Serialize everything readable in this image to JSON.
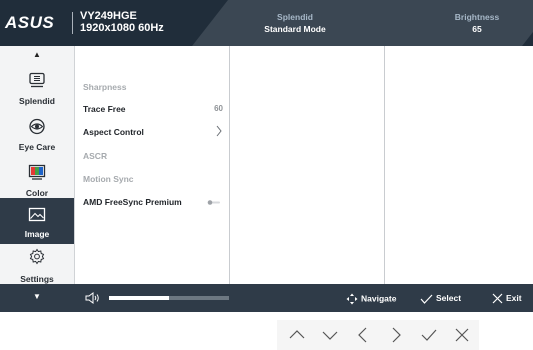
{
  "brand": "ASUS",
  "header": {
    "model": "VY249HGE",
    "resolution": "1920x1080 60Hz",
    "splendid_label": "Splendid",
    "splendid_value": "Standard Mode",
    "brightness_label": "Brightness",
    "brightness_value": "65"
  },
  "sidebar": {
    "items": [
      {
        "label": "Splendid",
        "icon": "splendid-icon"
      },
      {
        "label": "Eye Care",
        "icon": "eye-icon"
      },
      {
        "label": "Color",
        "icon": "color-icon"
      },
      {
        "label": "Image",
        "icon": "image-icon",
        "active": true
      },
      {
        "label": "Settings",
        "icon": "gear-icon"
      }
    ]
  },
  "menu": {
    "items": [
      {
        "label": "Sharpness",
        "enabled": false
      },
      {
        "label": "Trace Free",
        "enabled": true,
        "value": "60"
      },
      {
        "label": "Aspect Control",
        "enabled": true,
        "submenu": true
      },
      {
        "label": "ASCR",
        "enabled": false
      },
      {
        "label": "Motion Sync",
        "enabled": false
      },
      {
        "label": "AMD FreeSync Premium",
        "enabled": true,
        "toggle": "off"
      }
    ]
  },
  "footer": {
    "volume_level": 0.5,
    "navigate_label": "Navigate",
    "select_label": "Select",
    "exit_label": "Exit"
  },
  "colors": {
    "header_bg": "#202d3a",
    "panel_dark": "#2f3b48",
    "sidebar_bg": "#f3f4f5",
    "accent_label": "#a7b8c8"
  },
  "keys": [
    "up-icon",
    "down-icon",
    "left-icon",
    "right-icon",
    "check-icon",
    "close-icon"
  ]
}
